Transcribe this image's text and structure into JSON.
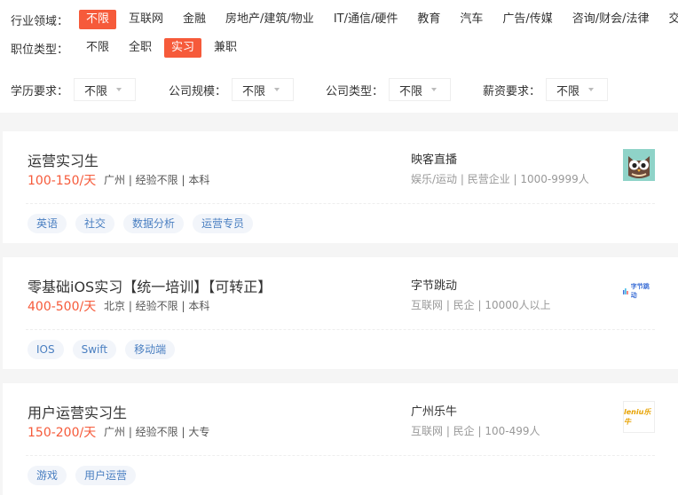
{
  "filters": {
    "industry": {
      "label": "行业领域：",
      "options": [
        "不限",
        "互联网",
        "金融",
        "房地产/建筑/物业",
        "IT/通信/硬件",
        "教育",
        "汽车",
        "广告/传媒",
        "咨询/财会/法律",
        "交"
      ],
      "active": "不限"
    },
    "job_type": {
      "label": "职位类型：",
      "options": [
        "不限",
        "全职",
        "实习",
        "兼职"
      ],
      "active": "实习"
    },
    "selects": [
      {
        "label": "学历要求：",
        "value": "不限"
      },
      {
        "label": "公司规模：",
        "value": "不限"
      },
      {
        "label": "公司类型：",
        "value": "不限"
      },
      {
        "label": "薪资要求：",
        "value": "不限"
      }
    ]
  },
  "jobs": [
    {
      "title": "运营实习生",
      "salary": "100-150/天",
      "meta": "广州 | 经验不限 | 本科",
      "company": "映客直播",
      "company_meta": "娱乐/运动 | 民营企业 | 1000-9999人",
      "tags": [
        "英语",
        "社交",
        "数据分析",
        "运营专员"
      ],
      "logo": "owl-logo"
    },
    {
      "title": "零基础iOS实习【统一培训】【可转正】",
      "salary": "400-500/天",
      "meta": "北京 | 经验不限 | 本科",
      "company": "字节跳动",
      "company_meta": "互联网 | 民企 | 10000人以上",
      "tags": [
        "IOS",
        "Swift",
        "移动端"
      ],
      "logo": "bytedance-logo",
      "logo_text": "字节跳动"
    },
    {
      "title": "用户运营实习生",
      "salary": "150-200/天",
      "meta": "广州 | 经验不限 | 大专",
      "company": "广州乐牛",
      "company_meta": "互联网 | 民企 | 100-499人",
      "tags": [
        "游戏",
        "用户运营"
      ],
      "logo": "leniu-logo",
      "logo_text": "leniu乐牛"
    }
  ]
}
